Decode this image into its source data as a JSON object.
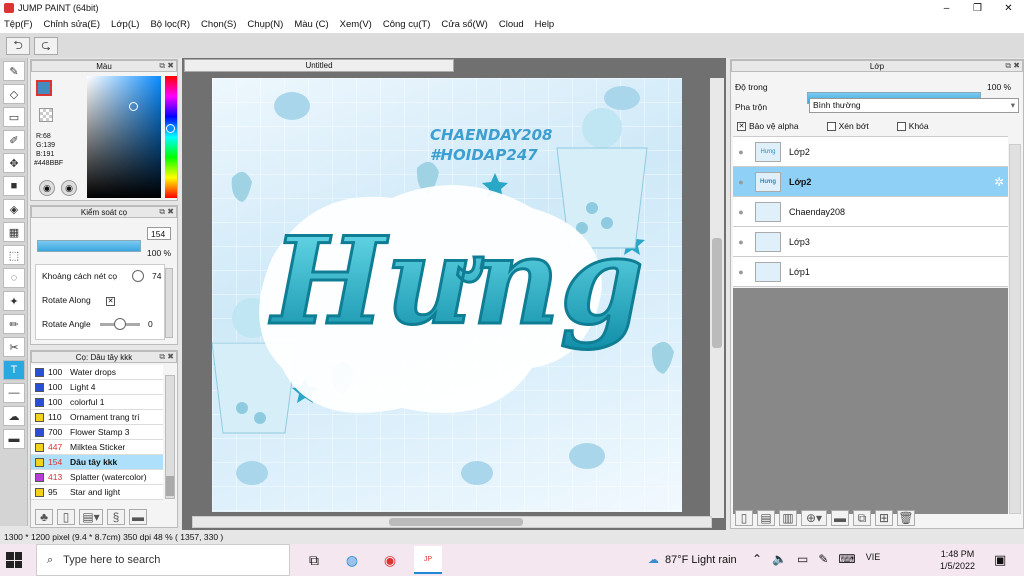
{
  "window": {
    "title": "JUMP PAINT (64bit)",
    "buttons": [
      "–",
      "❐",
      "✕"
    ]
  },
  "menu": [
    "Tệp(F)",
    "Chỉnh sửa(E)",
    "Lớp(L)",
    "Bộ lọc(R)",
    "Chọn(S)",
    "Chụp(N)",
    "Màu (C)",
    "Xem(V)",
    "Công cụ(T)",
    "Cửa sổ(W)",
    "Cloud",
    "Help"
  ],
  "color_panel": {
    "title": "Màu",
    "rgb": {
      "r": "R:68",
      "g": "G:139",
      "b": "B:191"
    },
    "hex": "#448BBF",
    "main_color": "#448bbf"
  },
  "brush_control": {
    "title": "Kiểm soát cọ",
    "size": "154",
    "opacity": "100 %",
    "spacing_label": "Khoảng cách nét cọ",
    "spacing_value": "74",
    "rotate_along_label": "Rotate Along",
    "rotate_angle_label": "Rotate Angle",
    "rotate_angle_value": "0"
  },
  "brush_list": {
    "title": "Cọ: Dâu tây kkk",
    "items": [
      {
        "size": "100",
        "name": "Water drops",
        "color": "#2a4fd6",
        "selected": false
      },
      {
        "size": "100",
        "name": "Light 4",
        "color": "#2a4fd6",
        "selected": false
      },
      {
        "size": "100",
        "name": "colorful 1",
        "color": "#2a4fd6",
        "selected": false
      },
      {
        "size": "110",
        "name": "Ornament trang trí",
        "color": "#f2d21b",
        "selected": false
      },
      {
        "size": "700",
        "name": "Flower Stamp 3",
        "color": "#2a4fd6",
        "selected": false
      },
      {
        "size": "447",
        "name": "Milktea Sticker",
        "color": "#f2d21b",
        "selected": false
      },
      {
        "size": "154",
        "name": "Dâu tây kkk",
        "color": "#f2d21b",
        "selected": true
      },
      {
        "size": "413",
        "name": "Splatter (watercolor)",
        "color": "#b83cd6",
        "selected": false
      },
      {
        "size": "95",
        "name": "Star and light",
        "color": "#f2d21b",
        "selected": false
      }
    ]
  },
  "canvas": {
    "tab": "Untitled",
    "title_text": "Hưng",
    "watermark1": "CHAENDAY208",
    "watermark2": "#HOIDAP247"
  },
  "layer_panel": {
    "title": "Lớp",
    "opacity_label": "Độ trong",
    "opacity_value": "100 %",
    "blend_label": "Pha trộn",
    "blend_value": "Bình thường",
    "protect_alpha": "Bảo vệ alpha",
    "clip": "Xén bớt",
    "lock": "Khóa",
    "layers": [
      {
        "name": "Lớp2",
        "thumb": "Hưng",
        "selected": false
      },
      {
        "name": "Lớp2",
        "thumb": "Hưng",
        "selected": true
      },
      {
        "name": "Chaenday208",
        "thumb": "",
        "selected": false
      },
      {
        "name": "Lớp3",
        "thumb": "",
        "selected": false
      },
      {
        "name": "Lớp1",
        "thumb": "",
        "selected": false
      }
    ]
  },
  "status": "1300 * 1200 pixel   (9.4 * 8.7cm)   350 dpi   48 %   ( 1357, 330 )",
  "taskbar": {
    "search_placeholder": "Type here to search",
    "weather": "87°F  Light rain",
    "lang": "VIE",
    "time": "1:48 PM",
    "date": "1/5/2022"
  }
}
